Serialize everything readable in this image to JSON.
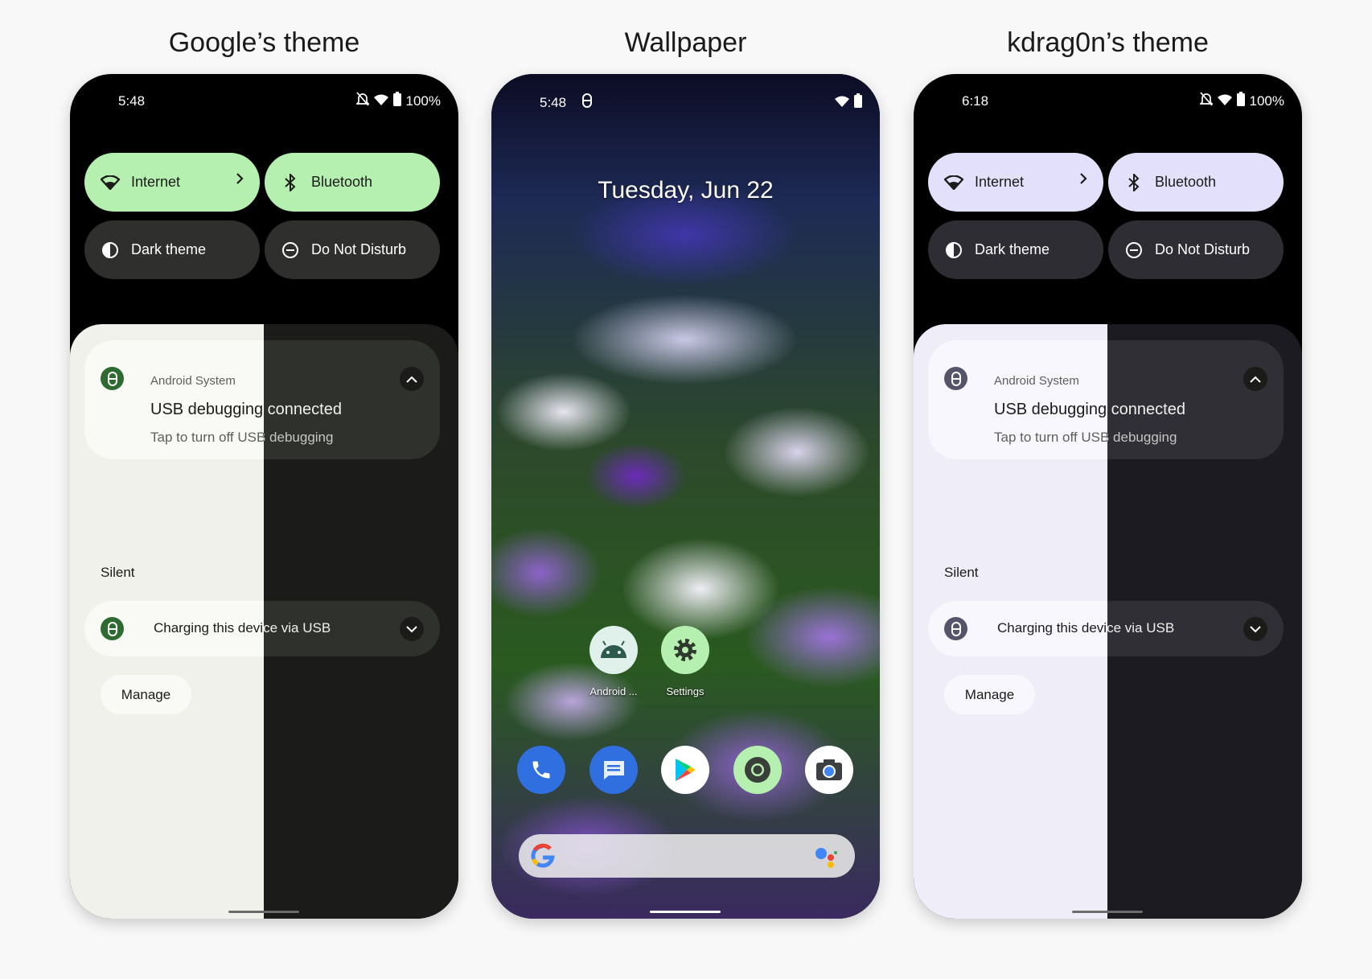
{
  "titles": [
    "Google’s theme",
    "Wallpaper",
    "kdrag0n’s theme"
  ],
  "phones": [
    {
      "time": "5:48",
      "battery": "100%",
      "accent": "#b6f0b0",
      "accent_icon": "#2e6b30",
      "light_bg": "#f1f1ec",
      "light_card": "#f9faf5",
      "dark_bg": "#1b1c1a",
      "dark_card": "#2f312d",
      "dark_tile": "#2f302d"
    },
    {
      "time": "5:48",
      "date": "Tuesday, Jun 22",
      "apps": [
        {
          "label": "Android ...",
          "icon": "android-icon"
        },
        {
          "label": "Settings",
          "icon": "gear-icon"
        }
      ],
      "dock": [
        "phone-icon",
        "messages-icon",
        "play-store-icon",
        "chrome-icon",
        "camera-icon"
      ]
    },
    {
      "time": "6:18",
      "battery": "100%",
      "accent": "#e2e0fa",
      "accent_icon": "#55546a",
      "light_bg": "#efedf8",
      "light_card": "#f8f7fe",
      "dark_bg": "#1c1b21",
      "dark_card": "#302f36",
      "dark_tile": "#2e2d33"
    }
  ],
  "tiles": {
    "internet": "Internet",
    "bluetooth": "Bluetooth",
    "dark_theme": "Dark theme",
    "dnd": "Do Not Disturb"
  },
  "notifications": {
    "app": "Android System",
    "title": "USB debugging connected",
    "subtitle": "Tap to turn off USB debugging",
    "section": "Silent",
    "charging": "Charging this device via USB",
    "manage": "Manage"
  }
}
